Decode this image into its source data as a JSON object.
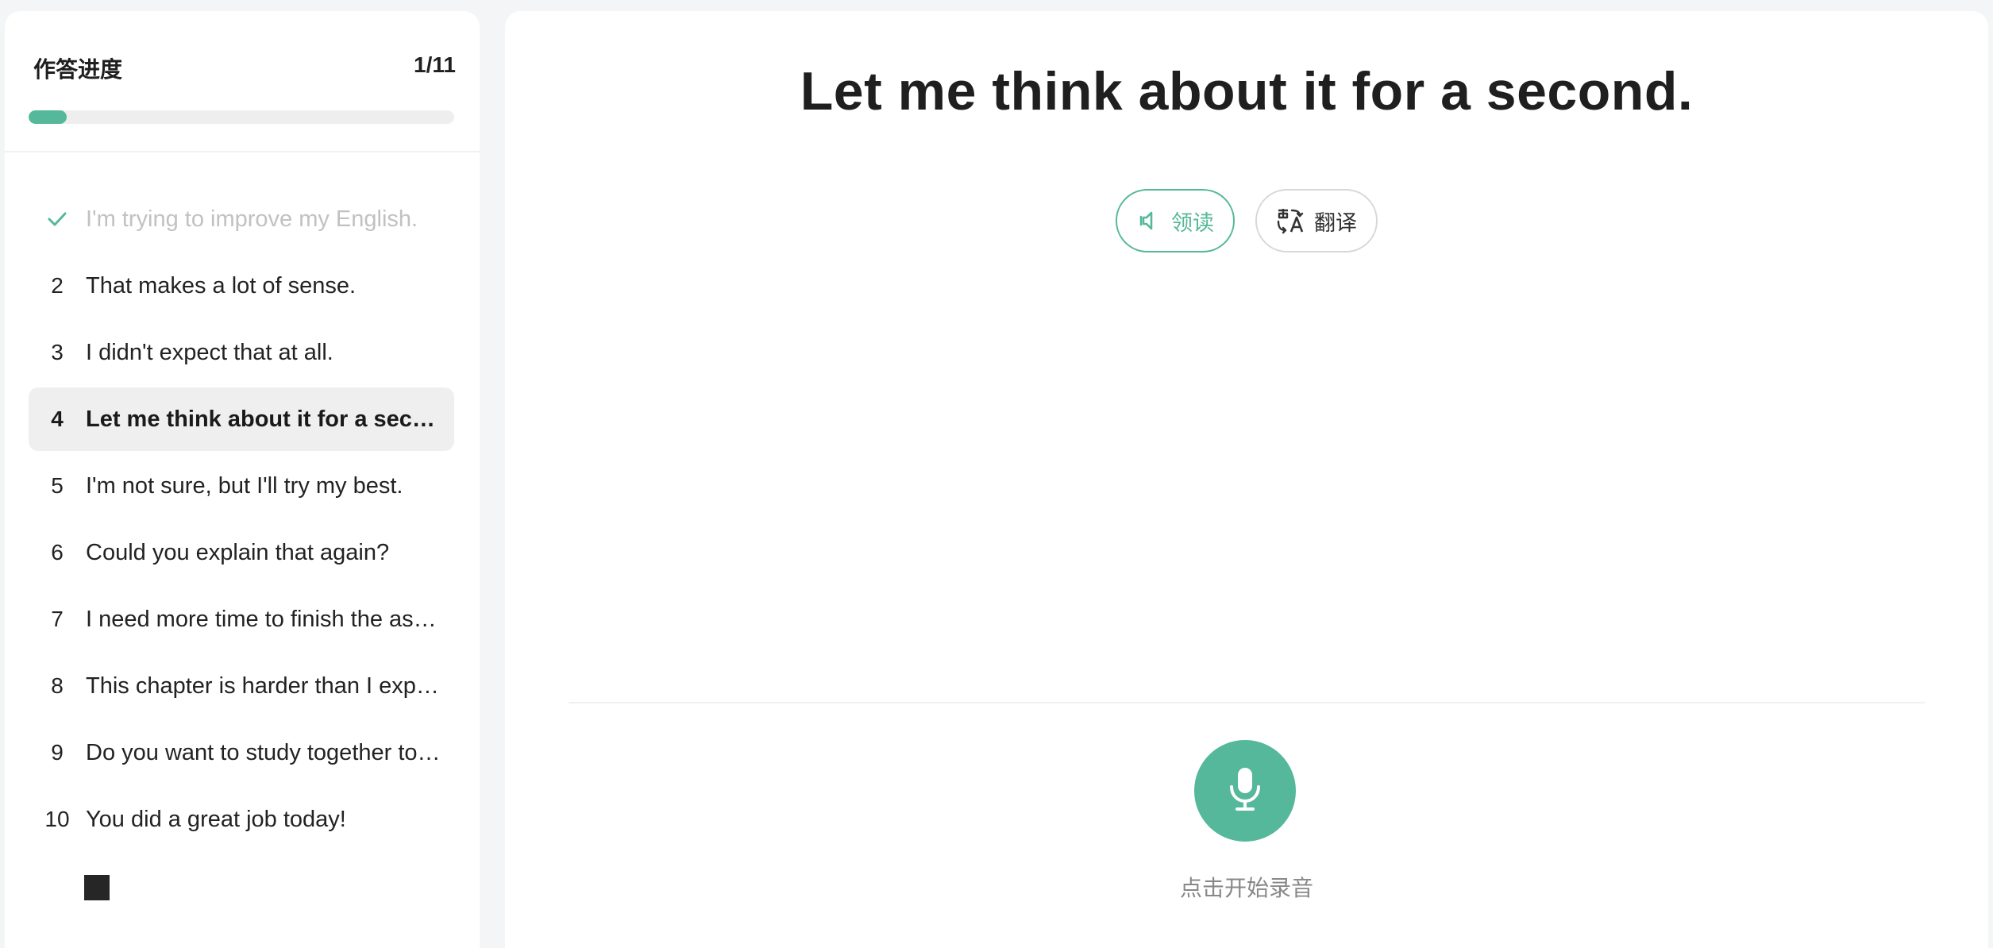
{
  "progress": {
    "title": "作答进度",
    "count": "1/11",
    "fraction": 0.09
  },
  "questions": [
    {
      "num": "",
      "text": "I'm trying to improve my English.",
      "status": "done"
    },
    {
      "num": "2",
      "text": "That makes a lot of sense.",
      "status": "todo"
    },
    {
      "num": "3",
      "text": "I didn't expect that at all.",
      "status": "todo"
    },
    {
      "num": "4",
      "text": "Let me think about it for a second.",
      "status": "active"
    },
    {
      "num": "5",
      "text": "I'm not sure, but I'll try my best.",
      "status": "todo"
    },
    {
      "num": "6",
      "text": "Could you explain that again?",
      "status": "todo"
    },
    {
      "num": "7",
      "text": "I need more time to finish the assignment.",
      "status": "todo"
    },
    {
      "num": "8",
      "text": "This chapter is harder than I expected.",
      "status": "todo"
    },
    {
      "num": "9",
      "text": "Do you want to study together tomorrow?",
      "status": "todo"
    },
    {
      "num": "10",
      "text": "You did a great job today!",
      "status": "todo"
    }
  ],
  "main": {
    "sentence": "Let me think about it for a second.",
    "read_label": "领读",
    "translate_label": "翻译",
    "mic_hint": "点击开始录音"
  },
  "icons": {
    "done": "check-icon",
    "read": "speaker-icon",
    "translate": "translate-icon",
    "record": "microphone-icon"
  },
  "colors": {
    "accent": "#55b89a",
    "done_text": "#c1c1c1",
    "active_bg": "#efefef"
  }
}
